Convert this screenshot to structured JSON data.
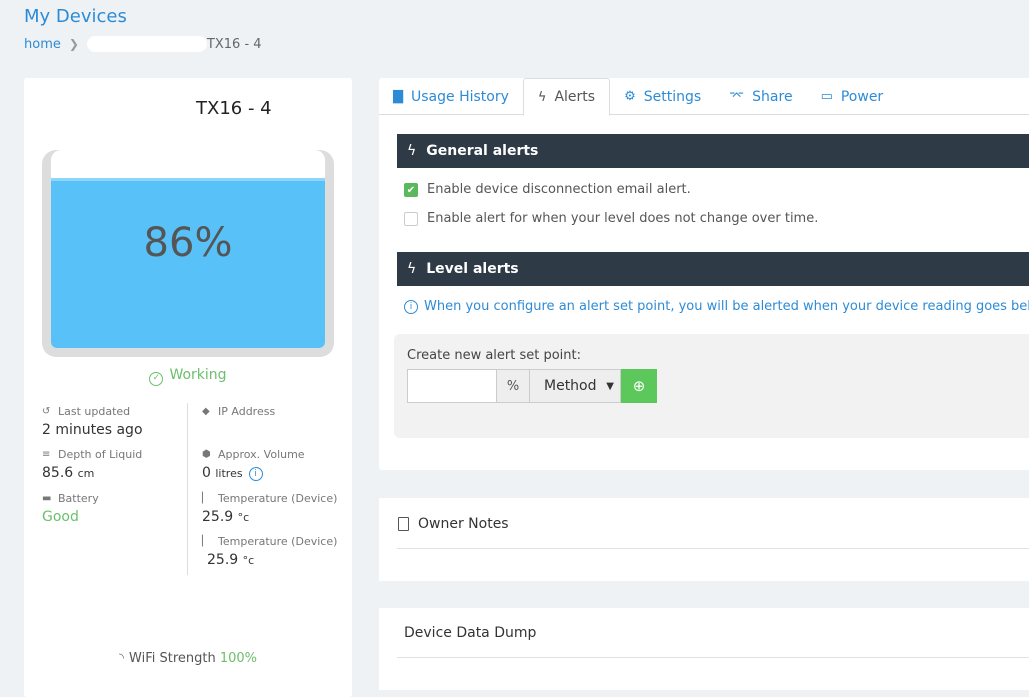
{
  "page": {
    "title": "My Devices"
  },
  "breadcrumb": {
    "home": "home",
    "current": "TX16 - 4"
  },
  "device": {
    "name": "TX16 - 4",
    "level_text": "86%",
    "level_fraction": 0.86,
    "status": "Working",
    "stats": {
      "last_updated_label": "Last updated",
      "last_updated_value": "2 minutes ago",
      "ip_label": "IP Address",
      "depth_label": "Depth of Liquid",
      "depth_value": "85.6",
      "depth_unit": "cm",
      "volume_label": "Approx. Volume",
      "volume_value": "0",
      "volume_unit": "litres",
      "battery_label": "Battery",
      "battery_value": "Good",
      "temp1_label": "Temperature (Device)",
      "temp1_value": "25.9",
      "temp1_unit": "°c",
      "temp2_label": "Temperature (Device)",
      "temp2_value": "25.9",
      "temp2_unit": "°c"
    },
    "wifi_label": "WiFi Strength",
    "wifi_value": "100%"
  },
  "tabs": [
    {
      "label": "Usage History",
      "icon": "bar-chart-icon"
    },
    {
      "label": "Alerts",
      "icon": "bolt-icon",
      "active": true
    },
    {
      "label": "Settings",
      "icon": "gear-icon"
    },
    {
      "label": "Share",
      "icon": "share-icon"
    },
    {
      "label": "Power",
      "icon": "battery-icon"
    }
  ],
  "alerts": {
    "general_title": "General alerts",
    "option_disconnect": "Enable device disconnection email alert.",
    "option_disconnect_checked": true,
    "option_nochange": "Enable alert for when your level does not change over time.",
    "option_nochange_checked": false,
    "level_title": "Level alerts",
    "info_text": "When you configure an alert set point, you will be alerted when your device reading goes below",
    "setpoint_label": "Create new alert set point:",
    "setpoint_value": "",
    "percent_symbol": "%",
    "method_selected": "Method"
  },
  "owner_notes": {
    "title": "Owner Notes"
  },
  "data_dump": {
    "title": "Device Data Dump"
  },
  "colors": {
    "accent": "#2d8bd6",
    "success": "#5cb85c",
    "water": "#58c1f7",
    "header_bar": "#2f3a47"
  }
}
